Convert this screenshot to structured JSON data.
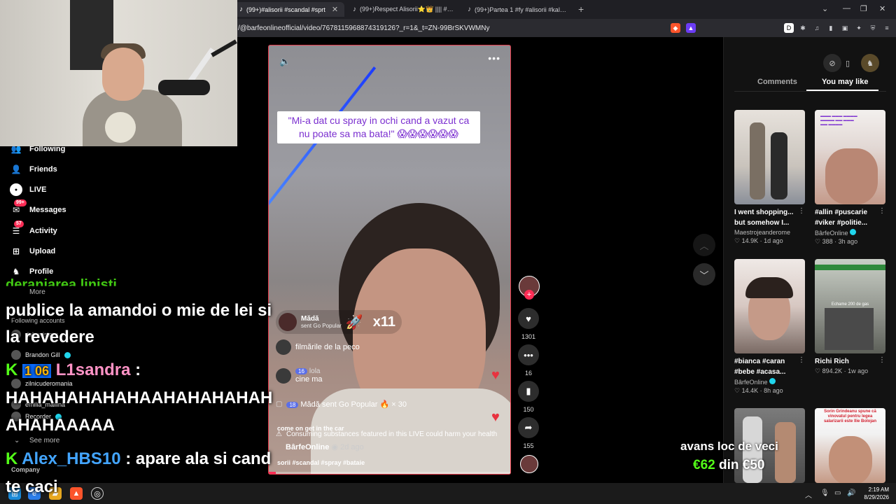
{
  "browser": {
    "tabs": [
      {
        "title": "(99+)#alisorii #scandal #sprt"
      },
      {
        "title": "(99+)Respect Alisorii⭐👑 |||| #foryo"
      },
      {
        "title": "(99+)Partea 1 #fy #alisorii #kalutv | T"
      }
    ],
    "new_tab": "+",
    "url": "/@barfeonlineofficial/video/7678115968874319126?_r=1&_t=ZN-99BrSKVWMNy"
  },
  "sidebar": {
    "items": [
      {
        "label": "Following",
        "icon": "following-icon"
      },
      {
        "label": "Friends",
        "icon": "friends-icon"
      },
      {
        "label": "LIVE",
        "icon": "live-icon"
      },
      {
        "label": "Messages",
        "icon": "messages-icon",
        "badge": "99+"
      },
      {
        "label": "Activity",
        "icon": "activity-icon",
        "badge": "57"
      },
      {
        "label": "Upload",
        "icon": "upload-icon"
      },
      {
        "label": "Profile",
        "icon": "profile-icon"
      }
    ],
    "more": "More",
    "following_accounts_title": "Following accounts",
    "accounts": [
      {
        "name": "dabunistory"
      },
      {
        "name": "Brandon Gill",
        "verified": true
      },
      {
        "name": "zilnicuderomania"
      },
      {
        "name": "emilia_mailina"
      },
      {
        "name": "Recorder",
        "verified": true
      }
    ],
    "see_more": "See more",
    "company": "Company"
  },
  "stream_chat": {
    "partial_top": "deranjarea linisti",
    "line1": "publice la amandoi o mie de lei si",
    "line2": "la revedere",
    "user2": "L1sandra",
    "user2_badge": "1 06",
    "msg2": "HAHAHAHAHAHAAHAHAHAHAH",
    "msg2b": "AHAHAAAAA",
    "user3": "Alex_HBS10",
    "msg3": "apare ala si cand",
    "msg3b": "te caci",
    "kick_icon": "K",
    "separator": ":"
  },
  "video": {
    "caption": "\"Mi-a dat cu spray in ochi cand a vazut ca nu poate sa ma bata!\" 😱😱😱😱😱😱",
    "gift": {
      "name": "Mădă",
      "sub": "sent Go Popular",
      "count": "x11"
    },
    "comments": [
      {
        "who": "",
        "text": "filmările de la peco"
      },
      {
        "who": "lola",
        "level": "16",
        "text": "cine ma"
      },
      {
        "who": "Mădă",
        "level": "18",
        "text": "sent Go Popular 🔥 × 30"
      }
    ],
    "overlay_text": "come on get in the car",
    "warning": "Consuming substances featured in this LIVE could harm your health",
    "author": "BârfeOnline",
    "time": "2d ago",
    "hashtags": "sorii #scandal #spray #bataie",
    "progress": 0.03
  },
  "actions": {
    "likes": "1301",
    "comments": "16",
    "saves": "150",
    "shares": "155"
  },
  "right_panel": {
    "tabs": [
      "Comments",
      "You may like"
    ],
    "active_tab": "You may like",
    "cards": [
      {
        "title": "I went shopping... but somehow I...",
        "author": "Maestrojeanderome",
        "likes": "14.9K",
        "time": "1d ago",
        "thumb_text": ""
      },
      {
        "title": "#allin #puscarie #viker #politie...",
        "author": "BârfeOnline",
        "likes": "388",
        "time": "3h ago",
        "thumb_text": ""
      },
      {
        "title": "#bianca #caran #bebe #acasa...",
        "author": "BârfeOnline",
        "likes": "14.4K",
        "time": "8h ago",
        "thumb_text": ""
      },
      {
        "title": "Richi Rich",
        "author": "",
        "likes": "894.2K",
        "time": "1w ago",
        "thumb_text": "Echame 200 de gas"
      },
      {
        "title": "",
        "author": "",
        "likes": "",
        "time": "",
        "thumb_text": ""
      },
      {
        "title": "",
        "author": "",
        "likes": "",
        "time": "",
        "thumb_text": "Sorin Grindeanu spune că vinovatul pentru legea salarizarii este Ilie Bolojan"
      }
    ]
  },
  "donation": {
    "line1": "avans loc de veci",
    "amount": "€62",
    "of": "din €50"
  },
  "taskbar": {
    "time": "2:19 AM",
    "date": "8/29/2026"
  }
}
